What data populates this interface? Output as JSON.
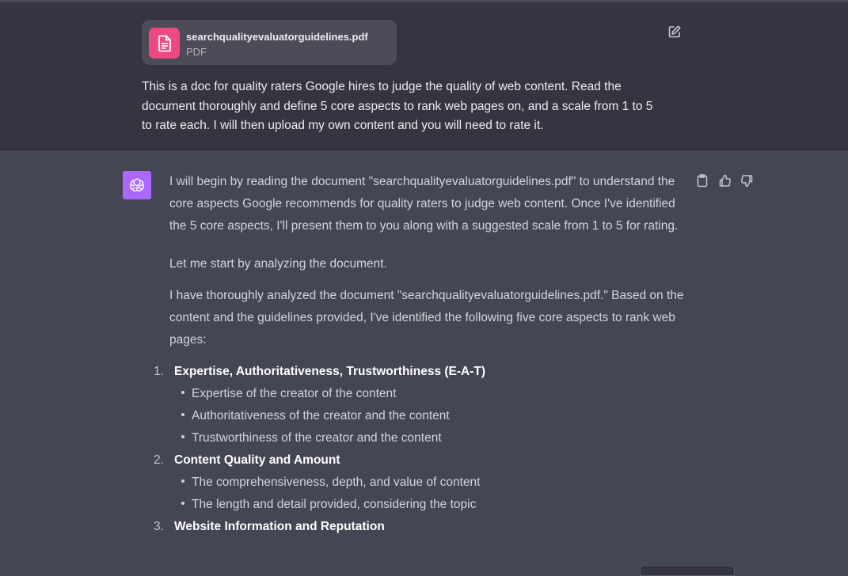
{
  "user": {
    "file": {
      "name": "searchqualityevaluatorguidelines.pdf",
      "type": "PDF"
    },
    "message": "This is a doc for quality raters Google hires to judge the quality of web content. Read the document thoroughly and define 5 core aspects to rank web pages on, and a scale from 1 to 5 to rate each. I will then upload my own content and you will need to rate it."
  },
  "assistant": {
    "intro": "I will begin by reading the document \"searchqualityevaluatorguidelines.pdf\" to understand the core aspects Google recommends for quality raters to judge web content. Once I've identified the 5 core aspects, I'll present them to you along with a suggested scale from 1 to 5 for rating.",
    "start": "Let me start by analyzing the document.",
    "analysis": "I have thoroughly analyzed the document \"searchqualityevaluatorguidelines.pdf.\" Based on the content and the guidelines provided, I've identified the following five core aspects to rank web pages:",
    "aspects": [
      {
        "num": "1.",
        "title": "Expertise, Authoritativeness, Trustworthiness (E-A-T)",
        "points": [
          "Expertise of the creator of the content",
          "Authoritativeness of the creator and the content",
          "Trustworthiness of the creator and the content"
        ]
      },
      {
        "num": "2.",
        "title": "Content Quality and Amount",
        "points": [
          "The comprehensiveness, depth, and value of content",
          "The length and detail provided, considering the topic"
        ]
      },
      {
        "num": "3.",
        "title": "Website Information and Reputation",
        "points": []
      }
    ]
  },
  "colors": {
    "user_bg": "#343541",
    "assistant_bg": "#444654",
    "file_icon": "#ef4a7f",
    "avatar": "#ab68ff"
  },
  "icons": {
    "file": "document-icon",
    "edit": "edit-icon",
    "avatar": "openai-logo-icon",
    "copy": "clipboard-icon",
    "like": "thumbs-up-icon",
    "dislike": "thumbs-down-icon"
  }
}
